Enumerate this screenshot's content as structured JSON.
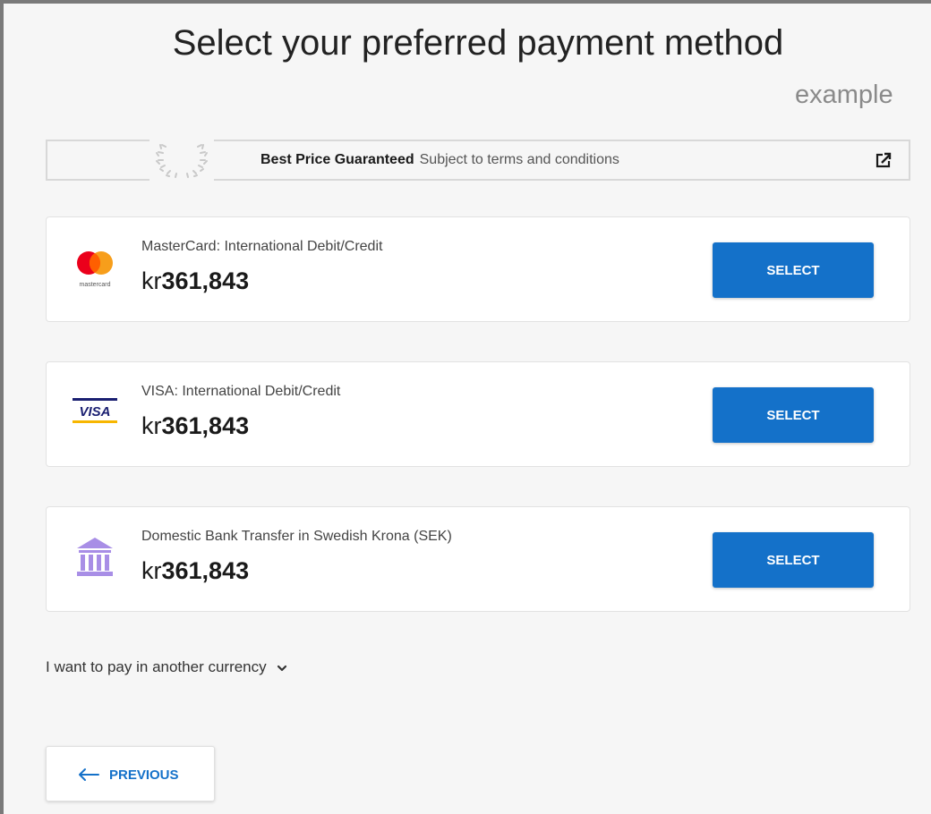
{
  "header": {
    "title": "Select your preferred payment method",
    "watermark": "example"
  },
  "guarantee": {
    "bold_text": "Best Price Guaranteed",
    "sub_text": "Subject to terms and conditions"
  },
  "payment_methods": [
    {
      "name": "MasterCard: International Debit/Credit",
      "currency": "kr",
      "amount": "361,843",
      "button_label": "SELECT",
      "logo_caption": "mastercard",
      "icon": "mastercard-logo-icon"
    },
    {
      "name": "VISA: International Debit/Credit",
      "currency": "kr",
      "amount": "361,843",
      "button_label": "SELECT",
      "logo_caption": "VISA",
      "icon": "visa-logo-icon"
    },
    {
      "name": "Domestic Bank Transfer in Swedish Krona (SEK)",
      "currency": "kr",
      "amount": "361,843",
      "button_label": "SELECT",
      "icon": "bank-icon"
    }
  ],
  "other_currency": {
    "label": "I want to pay in another currency"
  },
  "navigation": {
    "previous_label": "PREVIOUS"
  },
  "colors": {
    "accent": "#1471c9",
    "bank_icon": "#a88ee6",
    "mastercard_red": "#eb001b",
    "mastercard_orange": "#f79e1b",
    "visa_blue": "#1a1f71",
    "visa_gold": "#f7b600"
  }
}
